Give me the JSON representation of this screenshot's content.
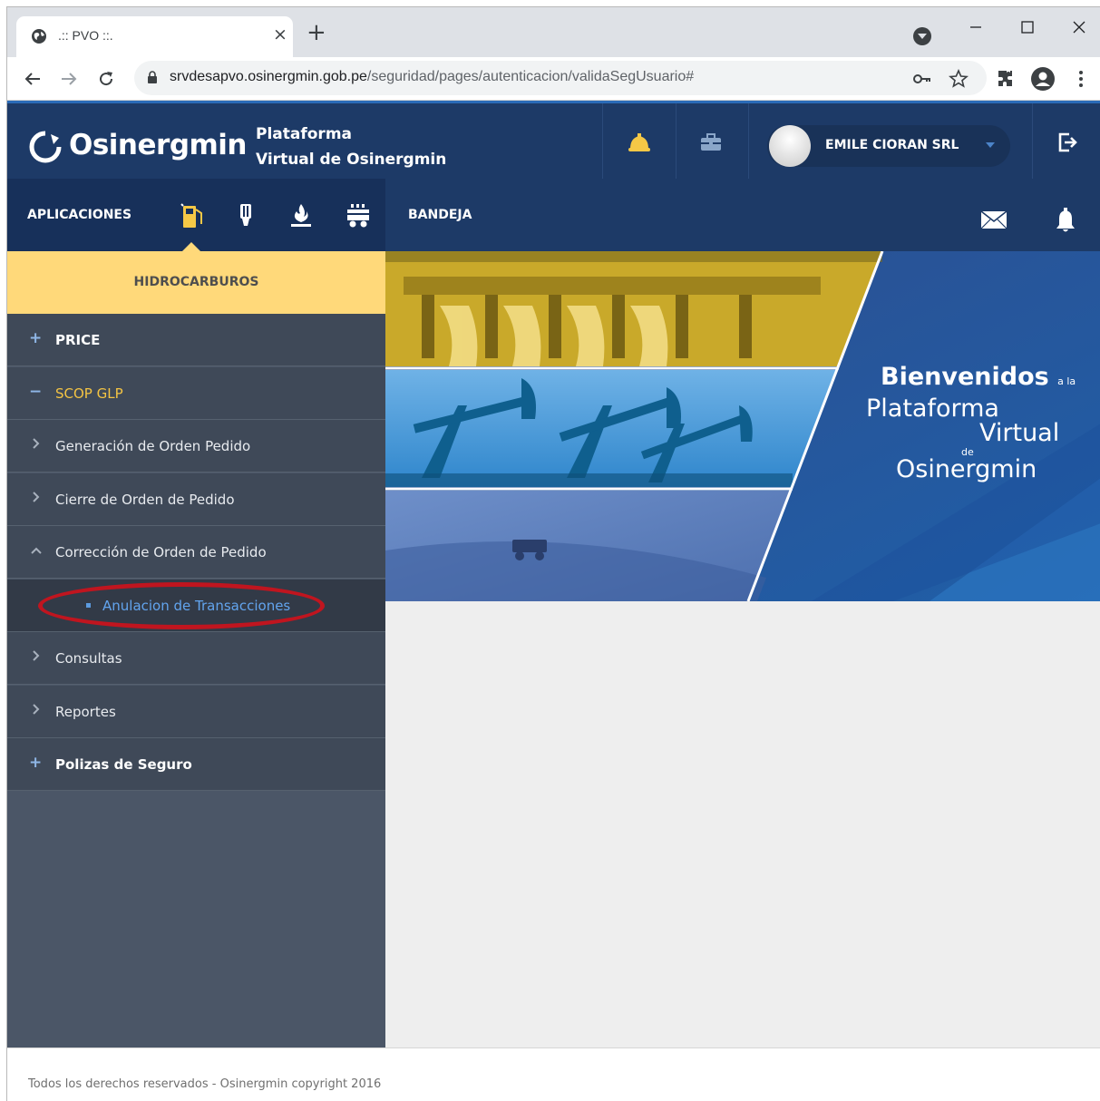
{
  "browser": {
    "tab_title": ".:: PVO ::.",
    "tab_close": "×",
    "new_tab": "+",
    "url_host": "srvdesapvo.osinergmin.gob.pe",
    "url_path": "/seguridad/pages/autenticacion/validaSegUsuario#"
  },
  "header": {
    "brand": "Osinergmin",
    "platform_line1": "Plataforma",
    "platform_line2": "Virtual de Osinergmin",
    "user_name": "EMILE CIORAN SRL"
  },
  "nav": {
    "apps_label": "APLICACIONES",
    "inbox_label": "BANDEJA"
  },
  "sidebar": {
    "section_title": "HIDROCARBUROS",
    "items": [
      {
        "mark": "+",
        "label": "PRICE"
      },
      {
        "mark": "−",
        "label": "SCOP GLP"
      },
      {
        "label": "Generación de Orden Pedido"
      },
      {
        "label": "Cierre de Orden de Pedido"
      },
      {
        "label": "Corrección de Orden de Pedido"
      },
      {
        "label": "Anulacion de Transacciones"
      },
      {
        "label": "Consultas"
      },
      {
        "label": "Reportes"
      },
      {
        "mark": "+",
        "label": "Polizas de Seguro"
      }
    ]
  },
  "banner": {
    "welcome_1": "Bienvenidos",
    "welcome_1_small": "a la",
    "welcome_2": "Plataforma",
    "welcome_3": "Virtual",
    "welcome_4": "de",
    "welcome_5": "Osinergmin"
  },
  "footer": {
    "copyright": "Todos los derechos reservados - Osinergmin copyright 2016"
  },
  "colors": {
    "header_bg": "#1d3a67",
    "nav_left_bg": "#17305a",
    "section_head_bg": "#ffd97a",
    "sidebar_bg": "#3f4958",
    "active_text": "#f4c443",
    "link_text": "#62a4ee",
    "highlight_ring": "#c0151f"
  }
}
